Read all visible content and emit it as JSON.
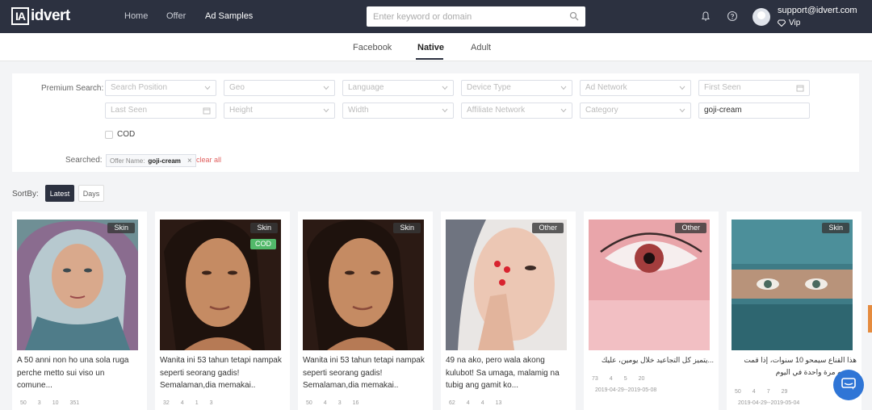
{
  "app": {
    "logo_mark": "IA",
    "logo_text": "idvert"
  },
  "nav": {
    "items": [
      {
        "label": "Home"
      },
      {
        "label": "Offer"
      },
      {
        "label": "Ad Samples"
      }
    ]
  },
  "search": {
    "placeholder": "Enter keyword or domain",
    "value": ""
  },
  "user": {
    "email": "support@idvert.com",
    "level": "Vip"
  },
  "tabs": [
    {
      "label": "Facebook"
    },
    {
      "label": "Native"
    },
    {
      "label": "Adult"
    }
  ],
  "filters": {
    "premium_label": "Premium Search:",
    "fields": [
      {
        "placeholder": "Search Position"
      },
      {
        "placeholder": "Geo"
      },
      {
        "placeholder": "Language"
      },
      {
        "placeholder": "Device Type"
      },
      {
        "placeholder": "Ad Network"
      },
      {
        "placeholder": "First Seen"
      },
      {
        "placeholder": "Last Seen"
      },
      {
        "placeholder": "Height"
      },
      {
        "placeholder": "Width"
      },
      {
        "placeholder": "Affiliate Network"
      },
      {
        "placeholder": "Category"
      },
      {
        "value": "goji-cream"
      }
    ],
    "cod_label": "COD",
    "searched_label": "Searched:",
    "chip_key": "Offer Name:",
    "chip_value": "goji-cream",
    "clear_all": "clear all"
  },
  "sort": {
    "label": "SortBy:",
    "options": [
      "Latest",
      "Days"
    ]
  },
  "cards": [
    {
      "badge": "Skin",
      "cod": "",
      "text": "A 50 anni non ho una sola ruga perche metto sui viso un comune...",
      "stats": [
        "50",
        "3",
        "10",
        "351"
      ]
    },
    {
      "badge": "Skin",
      "cod": "COD",
      "text": "Wanita ini 53 tahun tetapi nampak seperti seorang gadis! Semalaman,dia memakai..",
      "stats": [
        "32",
        "4",
        "1",
        "3"
      ]
    },
    {
      "badge": "Skin",
      "cod": "",
      "text": "Wanita ini 53 tahun tetapi nampak seperti seorang gadis! Semalaman,dia memakai..",
      "stats": [
        "50",
        "4",
        "3",
        "16"
      ]
    },
    {
      "badge": "Other",
      "cod": "",
      "text": "49 na ako, pero wala akong kulubot! Sa umaga, malamig na tubig ang gamit ko...",
      "stats": [
        "62",
        "4",
        "4",
        "13"
      ]
    },
    {
      "badge": "Other",
      "cod": "",
      "text": "...يتميز كل التجاعيد خلال يومين، عليك",
      "stats": [
        "73",
        "4",
        "5",
        "20"
      ],
      "date": "2019-04-29--2019-05-08"
    },
    {
      "badge": "Skin",
      "cod": "",
      "text": "هذا القناع سيمحو 10 سنوات، إذا قمت بوضعه مرة واحدة في اليوم",
      "stats": [
        "50",
        "4",
        "7",
        "29"
      ],
      "date": "2019-04-29--2019-05-04"
    }
  ],
  "colors": {
    "topbar": "#2c3140",
    "accent": "#2c3140",
    "cod_badge": "#52b96a",
    "chat": "#2f75d6",
    "clear_all": "#e0605f"
  }
}
